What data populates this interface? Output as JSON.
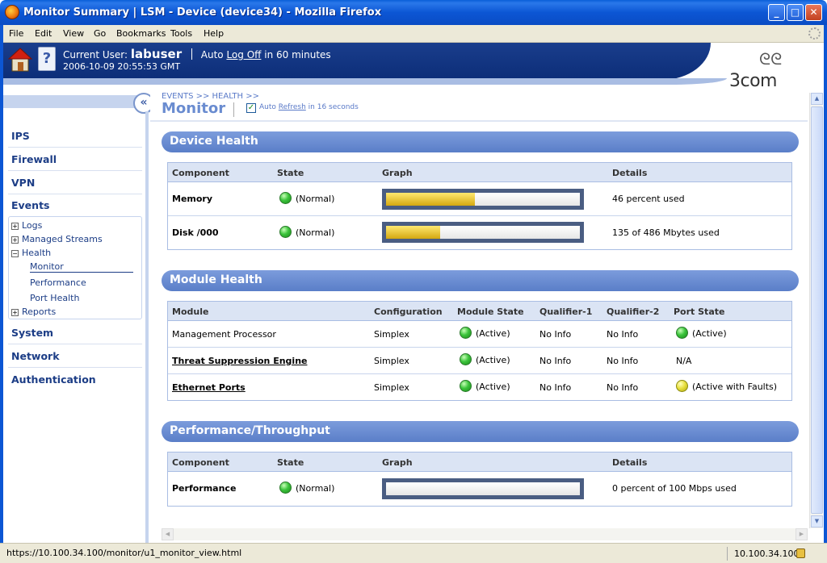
{
  "window": {
    "title": "Monitor Summary | LSM - Device (device34) - Mozilla Firefox",
    "buttons": {
      "minimize": "_",
      "maximize": "□",
      "close": "✕"
    }
  },
  "menu": [
    "File",
    "Edit",
    "View",
    "Go",
    "Bookmarks",
    "Tools",
    "Help"
  ],
  "header": {
    "current_user_label": "Current User:",
    "username": "labuser",
    "auto": "Auto",
    "logoff": "Log Off",
    "logoff_suffix": "in 60 minutes",
    "timestamp": "2006-10-09 20:55:53 GMT",
    "logo": "3com",
    "logo_mark": "ᘓᘓ",
    "help_glyph": "?"
  },
  "sidebar": {
    "collapse_glyph": "«",
    "sections": [
      "IPS",
      "Firewall",
      "VPN",
      "Events",
      "System",
      "Network",
      "Authentication"
    ],
    "events_tree": [
      {
        "label": "Logs",
        "expander": "+"
      },
      {
        "label": "Managed Streams",
        "expander": "+"
      },
      {
        "label": "Health",
        "expander": "−"
      },
      {
        "label": "Monitor"
      },
      {
        "label": "Performance"
      },
      {
        "label": "Port Health"
      },
      {
        "label": "Reports",
        "expander": "+"
      }
    ]
  },
  "page": {
    "breadcrumb": "EVENTS >> HEALTH >>",
    "title": "Monitor",
    "auto_label": "Auto",
    "refresh_link": "Refresh",
    "refresh_suffix": "in 16 seconds",
    "checkmark": "✓"
  },
  "device_health": {
    "title": "Device Health",
    "headers": [
      "Component",
      "State",
      "Graph",
      "Details"
    ],
    "rows": [
      {
        "component": "Memory",
        "state": "(Normal)",
        "percent": 46,
        "details": "46 percent used"
      },
      {
        "component": "Disk /000",
        "state": "(Normal)",
        "percent": 27.8,
        "details": "135 of 486 Mbytes used"
      }
    ]
  },
  "module_health": {
    "title": "Module Health",
    "headers": [
      "Module",
      "Configuration",
      "Module State",
      "Qualifier-1",
      "Qualifier-2",
      "Port State"
    ],
    "rows": [
      {
        "module": "Management Processor",
        "config": "Simplex",
        "state": "(Active)",
        "q1": "No Info",
        "q2": "No Info",
        "port": "(Active)"
      },
      {
        "module": "Threat Suppression Engine",
        "config": "Simplex",
        "state": "(Active)",
        "q1": "No Info",
        "q2": "No Info",
        "port": "N/A"
      },
      {
        "module": "Ethernet Ports",
        "config": "Simplex",
        "state": "(Active)",
        "q1": "No Info",
        "q2": "No Info",
        "port": "(Active with Faults)"
      }
    ]
  },
  "performance": {
    "title": "Performance/Throughput",
    "headers": [
      "Component",
      "State",
      "Graph",
      "Details"
    ],
    "rows": [
      {
        "component": "Performance",
        "state": "(Normal)",
        "percent": 0,
        "details": "0 percent of 100 Mbps used"
      }
    ]
  },
  "status": {
    "url": "https://10.100.34.100/monitor/u1_monitor_view.html",
    "ip": "10.100.34.100"
  },
  "colors": {
    "section_header": "#6a8cd0",
    "nav_text": "#1c3d86",
    "status_green": "#3cc43c",
    "status_yellow": "#e8e040",
    "bar_fill": "#e6c030"
  }
}
